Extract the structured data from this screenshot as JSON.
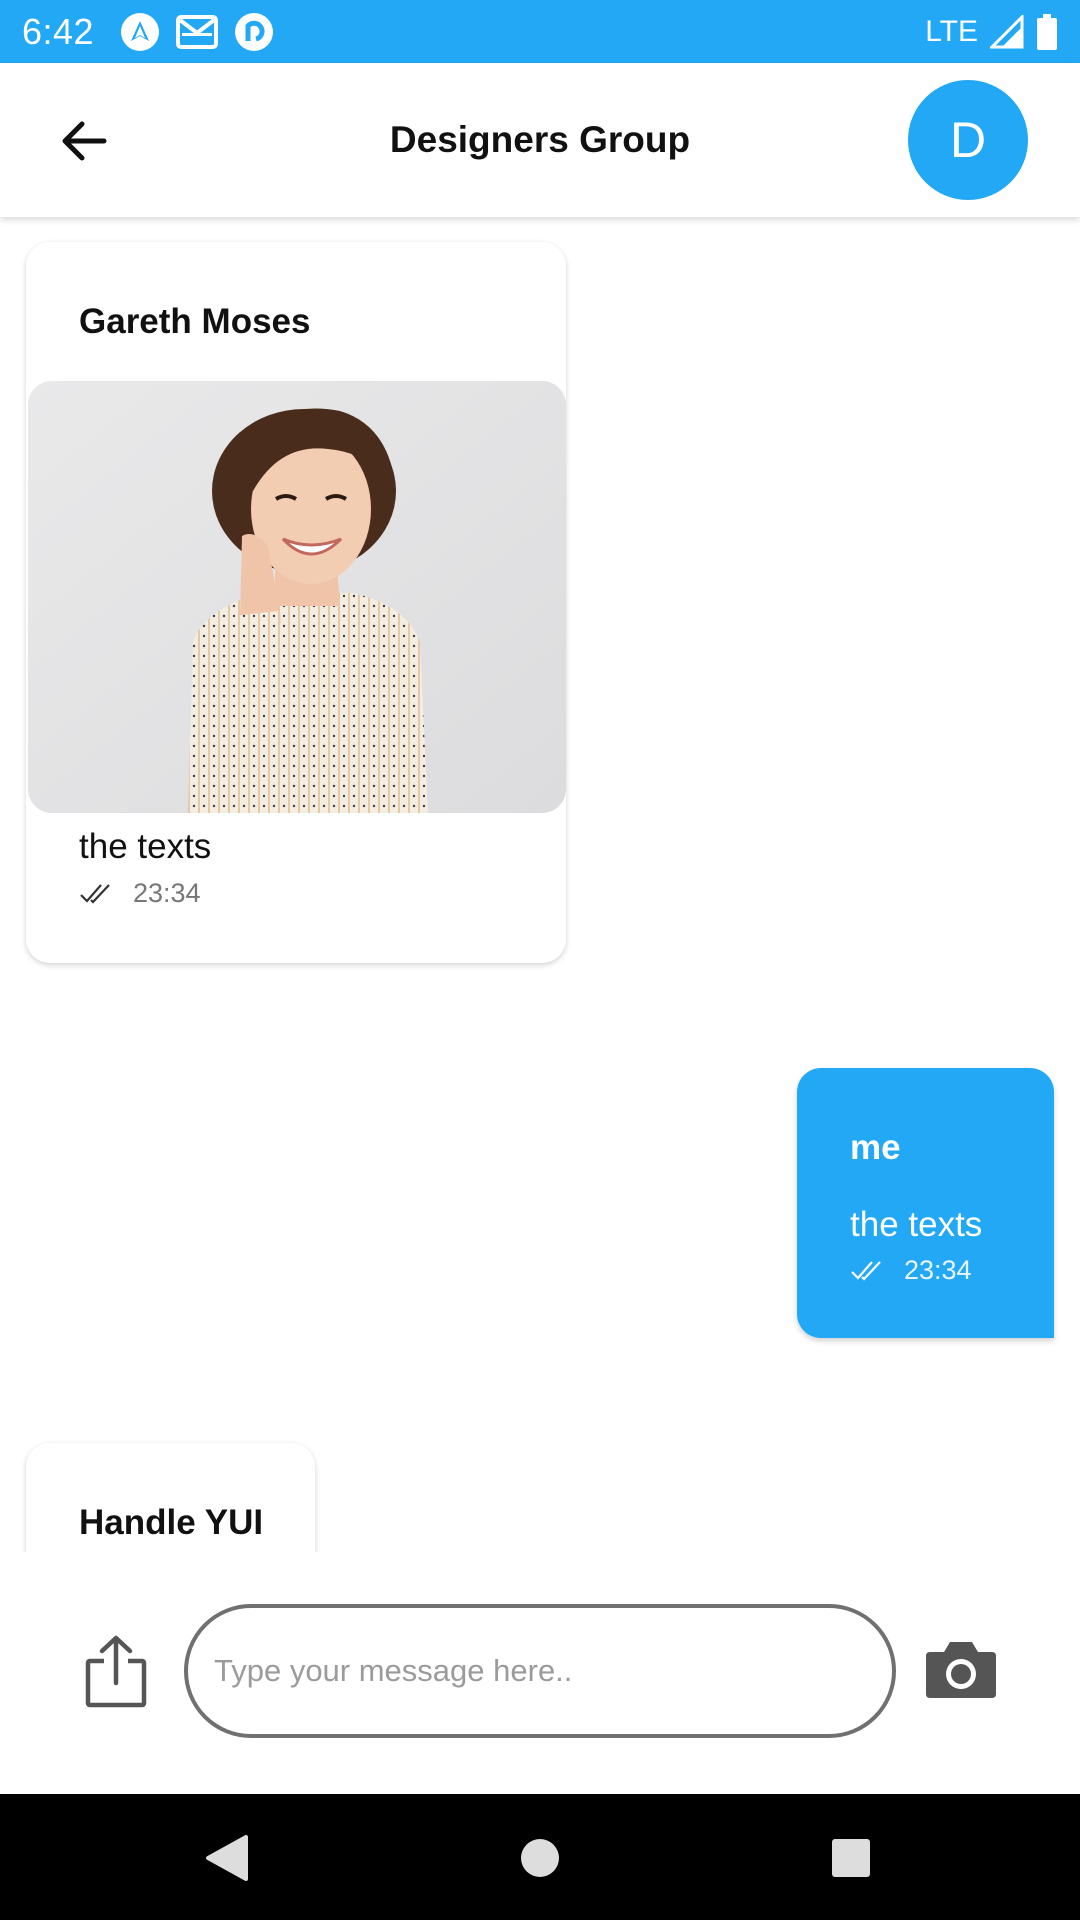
{
  "status_bar": {
    "time": "6:42",
    "network": "LTE",
    "icons": [
      "nav-app-icon",
      "gmail-icon",
      "pocket-casts-icon",
      "signal-icon",
      "battery-icon"
    ]
  },
  "header": {
    "title": "Designers Group",
    "avatar_letter": "D",
    "back_icon": "arrow-left-icon"
  },
  "messages": [
    {
      "sender": "Gareth Moses",
      "has_image": true,
      "image_description_icon": "photo-woman-smiling",
      "text": "the texts",
      "time": "23:34",
      "status_icon": "double-check-icon"
    },
    {
      "sender": "me",
      "text": "the texts",
      "time": "23:34",
      "status_icon": "double-check-icon"
    },
    {
      "sender": "Handle YUI"
    }
  ],
  "composer": {
    "placeholder": "Type your message here..",
    "value": "",
    "share_icon": "share-upload-icon",
    "camera_icon": "camera-icon"
  },
  "nav_bar": {
    "icons": [
      "back-triangle-icon",
      "home-circle-icon",
      "recents-square-icon"
    ]
  },
  "colors": {
    "accent": "#22a8f5",
    "text": "#111111",
    "meta": "#777777"
  }
}
